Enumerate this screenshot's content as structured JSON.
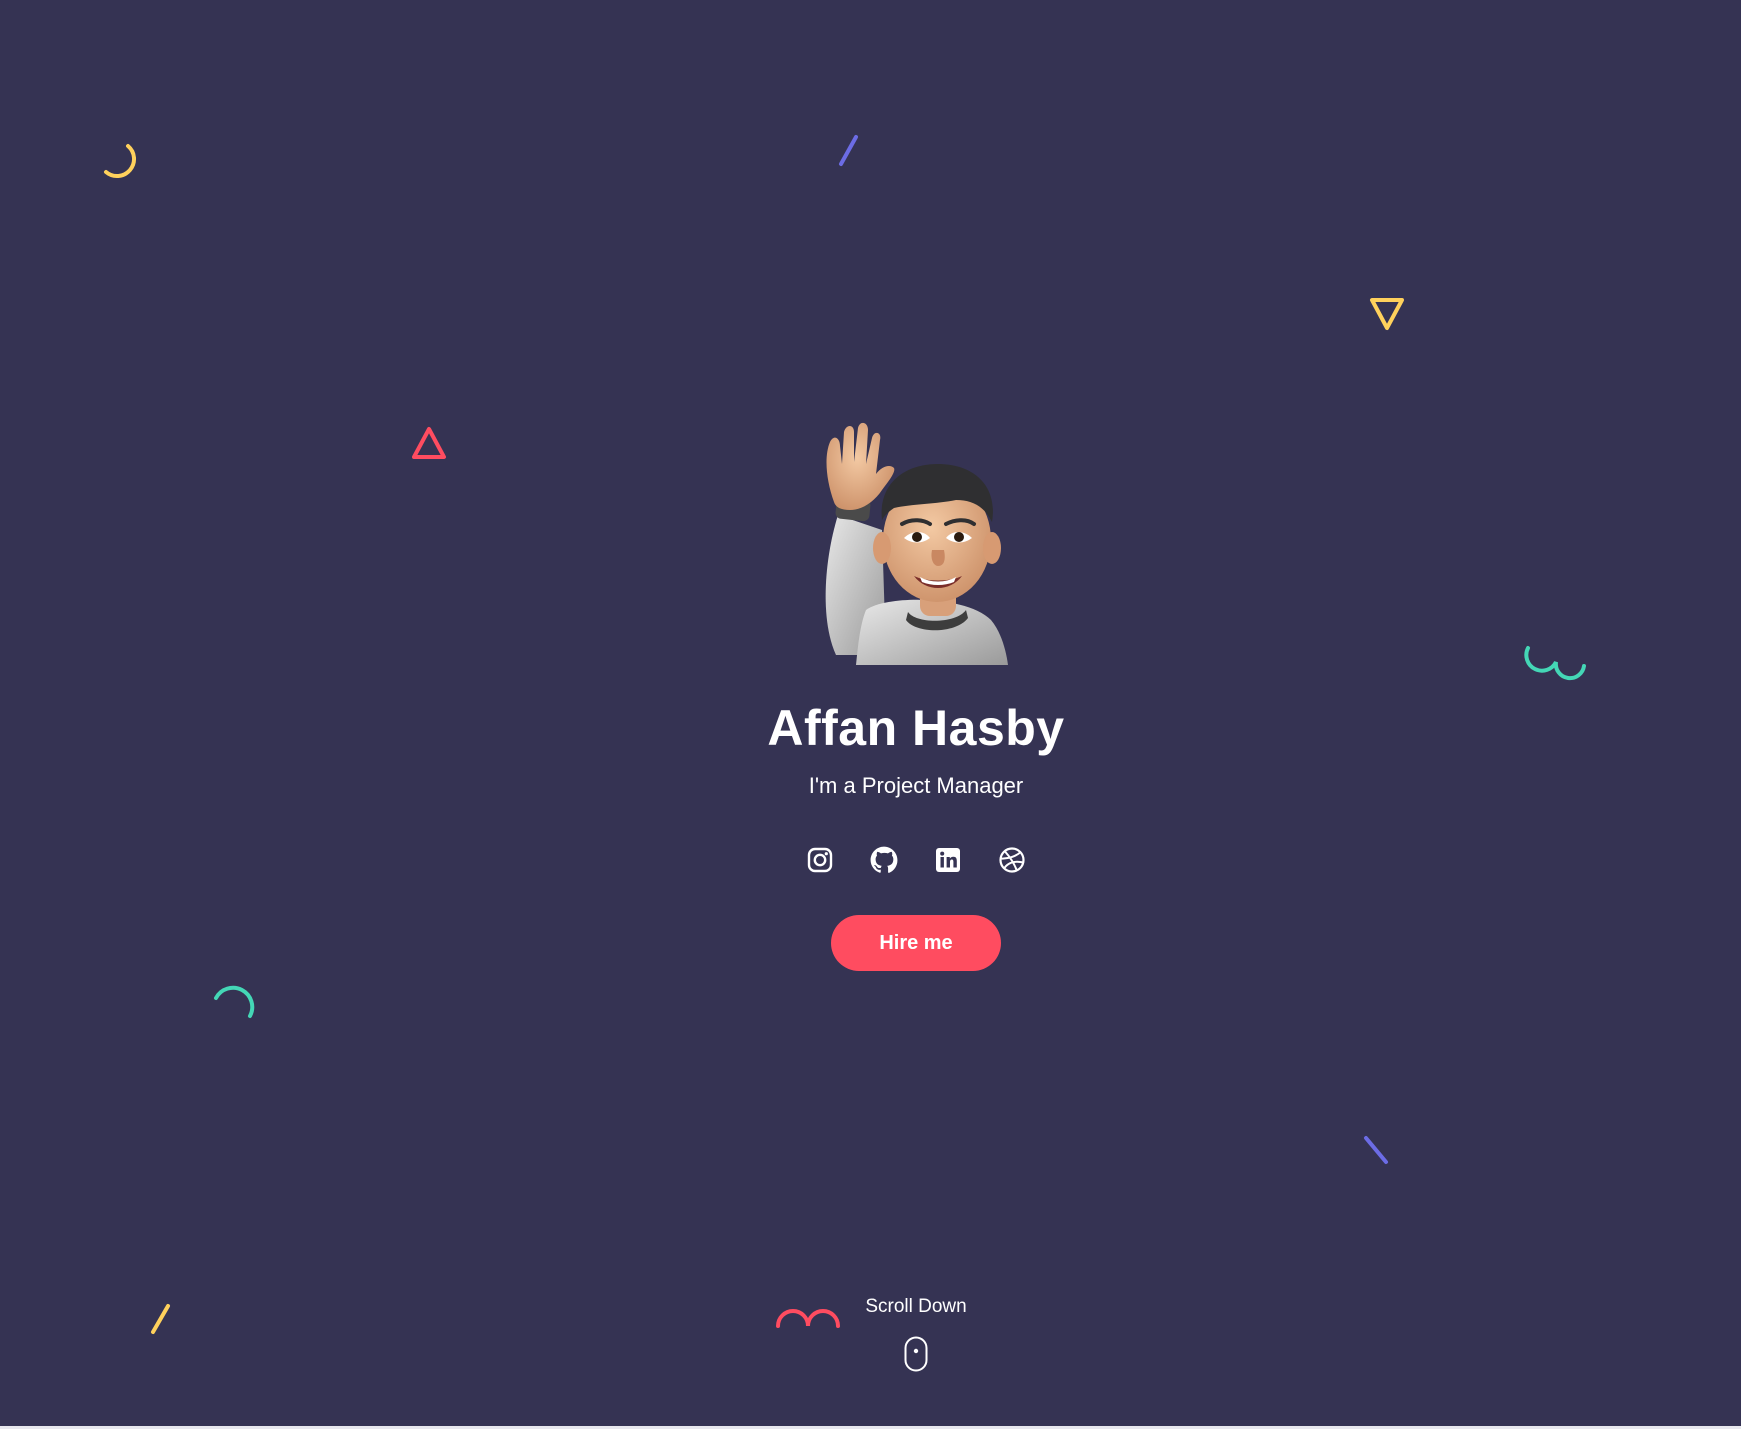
{
  "colors": {
    "background": "#353353",
    "accent": "#ff4c60",
    "yellow": "#ffd15c",
    "teal": "#44d7b6",
    "purple": "#6c6ce5",
    "text": "#ffffff"
  },
  "hero": {
    "avatar_icon": "waving-memoji-avatar",
    "name": "Affan Hasby",
    "subtitle": "I'm a Project Manager",
    "socials": [
      {
        "icon": "instagram-icon"
      },
      {
        "icon": "github-icon"
      },
      {
        "icon": "linkedin-icon"
      },
      {
        "icon": "dribbble-icon"
      }
    ],
    "cta_label": "Hire me"
  },
  "scroll": {
    "label": "Scroll Down",
    "icon": "mouse-icon"
  }
}
